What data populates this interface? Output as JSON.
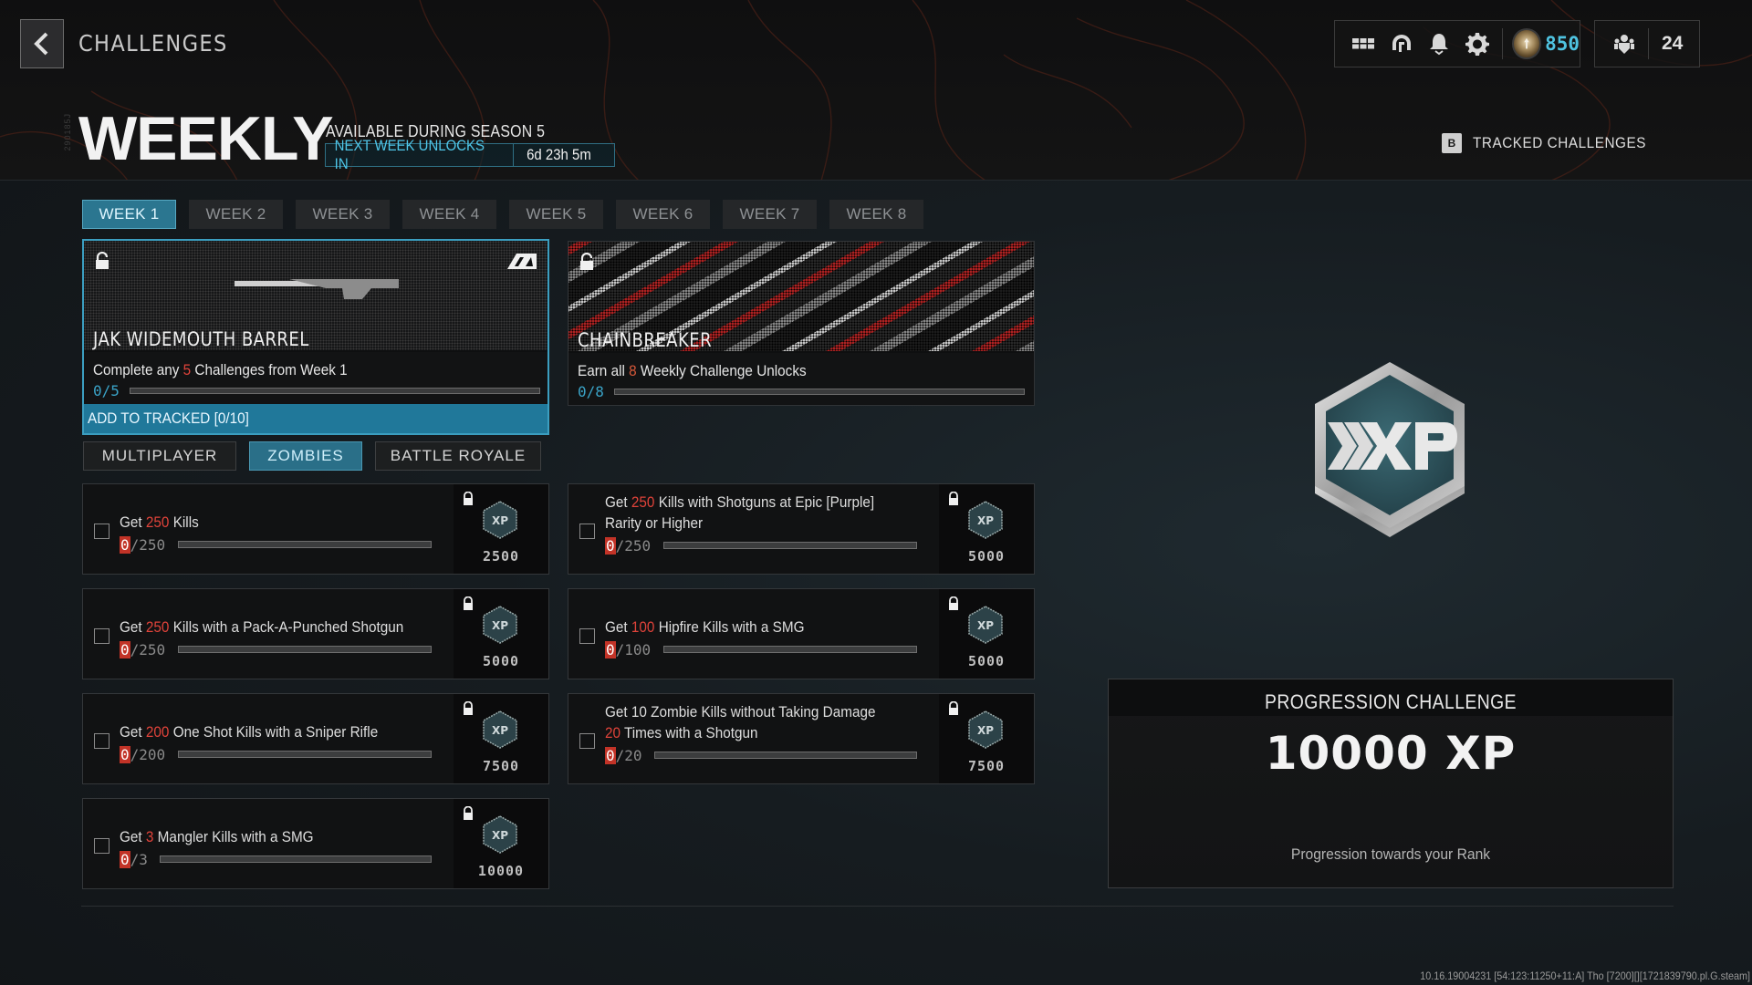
{
  "header": {
    "back_label": "Back",
    "page_crumb": "CHALLENGES",
    "top_icons": [
      "grid-menu-icon",
      "headset-icon",
      "bell-icon",
      "gear-icon"
    ],
    "currency": {
      "icon": "currency-coin-icon",
      "value": "850"
    },
    "party": {
      "icon": "party-icon",
      "count": "24"
    }
  },
  "section": {
    "watermark": "290185J",
    "title": "WEEKLY",
    "availability": "AVAILABLE DURING SEASON 5",
    "next_unlock_label": "NEXT WEEK UNLOCKS IN",
    "next_unlock_time": "6d 23h 5m",
    "tracked_key": "B",
    "tracked_label": "TRACKED CHALLENGES"
  },
  "week_tabs": [
    {
      "label": "WEEK 1",
      "active": true
    },
    {
      "label": "WEEK 2",
      "active": false
    },
    {
      "label": "WEEK 3",
      "active": false
    },
    {
      "label": "WEEK 4",
      "active": false
    },
    {
      "label": "WEEK 5",
      "active": false
    },
    {
      "label": "WEEK 6",
      "active": false
    },
    {
      "label": "WEEK 7",
      "active": false
    },
    {
      "label": "WEEK 8",
      "active": false
    }
  ],
  "unlock_cards": [
    {
      "title": "JAK WIDEMOUTH BARREL",
      "desc_pre": "Complete any ",
      "desc_num": "5",
      "desc_post": " Challenges from Week 1",
      "progress_text": "0/5",
      "progress": 0,
      "action_label": "ADD TO TRACKED [0/10]"
    },
    {
      "title": "CHAINBREAKER",
      "desc_pre": "Earn all ",
      "desc_num": "8",
      "desc_post": " Weekly Challenge Unlocks",
      "progress_text": "0/8",
      "progress": 0
    }
  ],
  "mode_tabs": [
    {
      "label": "MULTIPLAYER",
      "active": false
    },
    {
      "label": "ZOMBIES",
      "active": true
    },
    {
      "label": "BATTLE ROYALE",
      "active": false
    }
  ],
  "challenges": [
    {
      "pre": "Get ",
      "num": "250",
      "post": " Kills",
      "line2": "",
      "current": "0",
      "total": "/250",
      "progress": 0,
      "xp": "2500"
    },
    {
      "pre": "Get ",
      "num": "250",
      "post": " Kills with Shotguns at Epic [Purple]",
      "line2": "Rarity or Higher",
      "current": "0",
      "total": "/250",
      "progress": 0,
      "xp": "5000"
    },
    {
      "pre": "Get ",
      "num": "250",
      "post": " Kills with a Pack-A-Punched Shotgun",
      "line2": "",
      "current": "0",
      "total": "/250",
      "progress": 0,
      "xp": "5000"
    },
    {
      "pre": "Get ",
      "num": "100",
      "post": " Hipfire Kills with a SMG",
      "line2": "",
      "current": "0",
      "total": "/100",
      "progress": 0,
      "xp": "5000"
    },
    {
      "pre": "Get ",
      "num": "200",
      "post": " One Shot Kills with a Sniper Rifle",
      "line2": "",
      "current": "0",
      "total": "/200",
      "progress": 0,
      "xp": "7500"
    },
    {
      "pre": "Get 10 Zombie Kills without Taking Damage",
      "num": "20",
      "post": " Times with a Shotgun",
      "line2": "",
      "current": "0",
      "total": "/20",
      "progress": 0,
      "xp": "7500",
      "num_on_second_line": true
    },
    {
      "pre": "Get ",
      "num": "3",
      "post": " Mangler Kills with a SMG",
      "line2": "",
      "current": "0",
      "total": "/3",
      "progress": 0,
      "xp": "10000"
    }
  ],
  "progression": {
    "badge_icon": "xp-badge-icon",
    "title": "PROGRESSION CHALLENGE",
    "reward": "10000 XP",
    "subtitle": "Progression towards your Rank"
  },
  "colors": {
    "accent": "#2b7690",
    "accent_text": "#4fc6e8",
    "highlight_red": "#e0433a",
    "background": "#161c20"
  },
  "build_info": "10.16.19004231 [54:123:11250+11:A] Tho [7200][][1721839790.pl.G.steam]"
}
